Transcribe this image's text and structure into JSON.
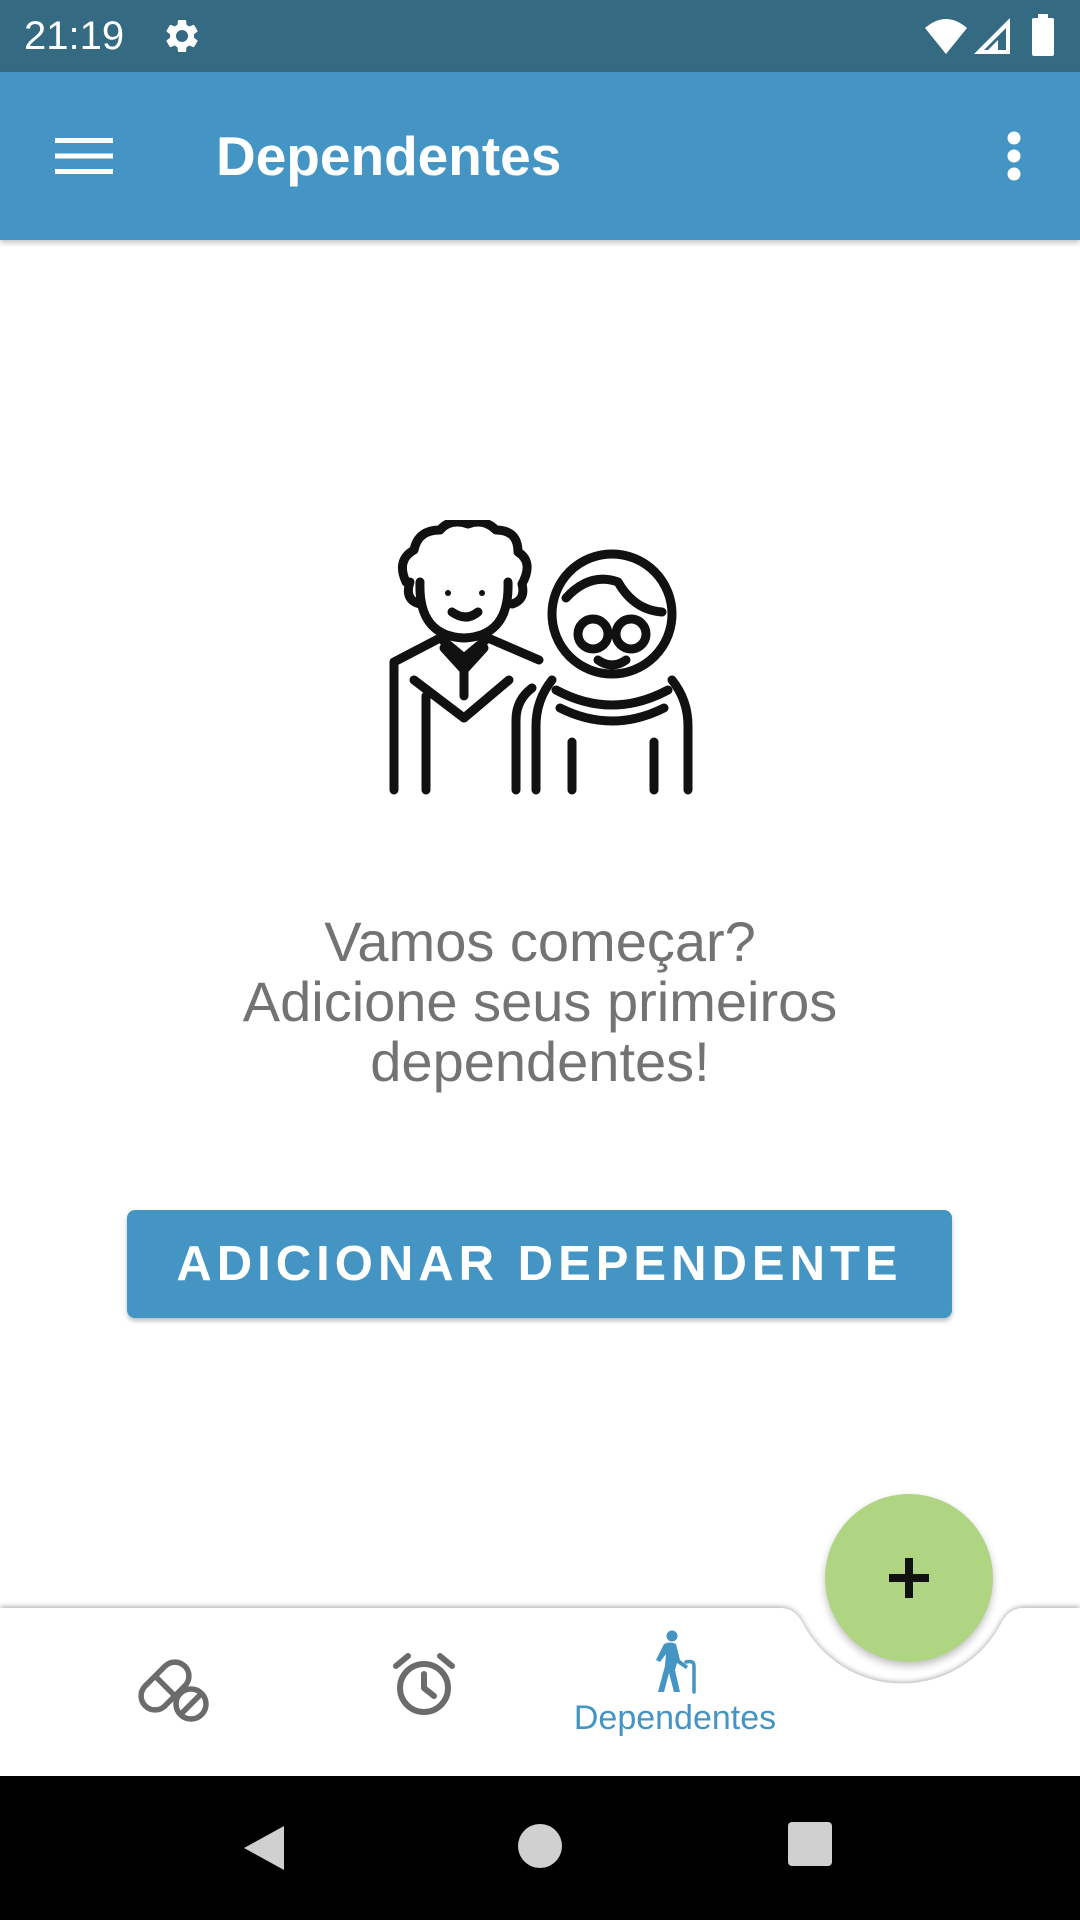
{
  "status_bar": {
    "time": "21:19",
    "icons": [
      "gear-icon",
      "wifi-icon",
      "signal-icon",
      "battery-icon"
    ]
  },
  "app_bar": {
    "title": "Dependentes",
    "menu_icon": "hamburger-menu-icon",
    "overflow_icon": "more-vert-icon"
  },
  "empty_state": {
    "illustration": "elderly-couple-icon",
    "message_lines": [
      "Vamos começar?",
      "Adicione seus primeiros",
      "dependentes!"
    ],
    "button_label": "ADICIONAR DEPENDENTE"
  },
  "bottom_nav": {
    "items": [
      {
        "icon": "pills-icon",
        "label": ""
      },
      {
        "icon": "alarm-clock-icon",
        "label": ""
      },
      {
        "icon": "elderly-walker-icon",
        "label": "Dependentes",
        "selected": true
      }
    ]
  },
  "fab": {
    "icon": "plus-icon"
  },
  "colors": {
    "status_bar": "#356a83",
    "primary": "#4495c3",
    "fab": "#b0d582",
    "message_text": "#737373",
    "nav_icon": "#6b6b6b"
  },
  "system_nav": {
    "icons": [
      "back-icon",
      "home-icon",
      "recents-icon"
    ]
  }
}
